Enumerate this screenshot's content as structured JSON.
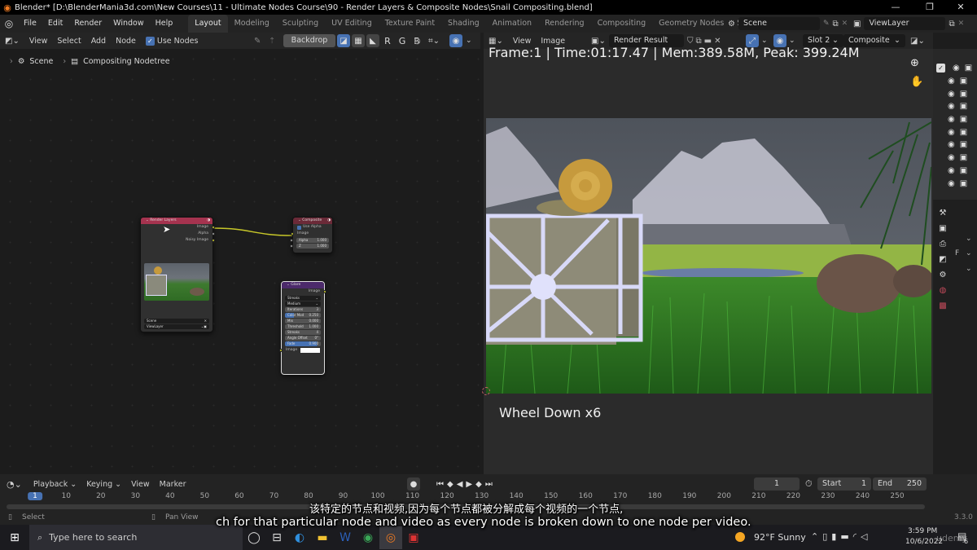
{
  "window": {
    "title": "Blender* [D:\\BlenderMania3d.com\\New Courses\\11 - Ultimate Nodes Course\\90 - Render Layers & Composite Nodes\\Snail Compositing.blend]",
    "minimize": "—",
    "maximize": "❐",
    "close": "✕"
  },
  "menus": [
    "File",
    "Edit",
    "Render",
    "Window",
    "Help"
  ],
  "workspaces": [
    {
      "label": "Layout",
      "active": true
    },
    {
      "label": "Modeling"
    },
    {
      "label": "Sculpting"
    },
    {
      "label": "UV Editing"
    },
    {
      "label": "Texture Paint"
    },
    {
      "label": "Shading"
    },
    {
      "label": "Animation"
    },
    {
      "label": "Rendering"
    },
    {
      "label": "Compositing"
    },
    {
      "label": "Geometry Nodes"
    },
    {
      "label": "Scripting"
    }
  ],
  "add_workspace": "+",
  "scene_selector": "Scene",
  "viewlayer_selector": "ViewLayer",
  "node_editor": {
    "menus": [
      "View",
      "Select",
      "Add",
      "Node"
    ],
    "use_nodes_label": "Use Nodes",
    "use_nodes_checked": true,
    "backdrop_label": "Backdrop",
    "channels": [
      "R",
      "G",
      "B"
    ],
    "breadcrumb": [
      "Scene",
      "Compositing Nodetree"
    ],
    "nodes": {
      "render_layers": {
        "title": "Render Layers",
        "outputs": [
          "Image",
          "Alpha",
          "Noisy Image"
        ],
        "scene": "Scene",
        "view_layer": "ViewLayer",
        "header_color": "#a5334f"
      },
      "composite": {
        "title": "Composite",
        "use_alpha_label": "Use Alpha",
        "use_alpha_checked": true,
        "input_label": "Image",
        "fields": [
          {
            "label": "Alpha",
            "value": "1.000"
          },
          {
            "label": "Z",
            "value": "1.000"
          }
        ],
        "header_color": "#6b2a38"
      },
      "glare": {
        "title": "Glare",
        "output": "Image",
        "dropdowns": [
          "Streaks",
          "Medium"
        ],
        "fields": [
          {
            "label": "Iterations",
            "value": "3"
          },
          {
            "label": "Color Mod",
            "value": "0.250",
            "progress": 0.25
          },
          {
            "label": "Mix",
            "value": "0.000"
          },
          {
            "label": "Threshold",
            "value": "1.000"
          },
          {
            "label": "Streaks",
            "value": "4"
          },
          {
            "label": "Angle Offset",
            "value": "0°"
          },
          {
            "label": "Fade",
            "value": "0.900",
            "progress": 0.9
          }
        ],
        "input_label": "Image",
        "header_color": "#4c2a6b"
      }
    }
  },
  "image_editor": {
    "menus": [
      "View",
      "Image"
    ],
    "image_name": "Render Result",
    "slot": "Slot 2",
    "layer": "Composite",
    "stats": "Frame:1 | Time:01:17.47 | Mem:389.58M, Peak: 399.24M",
    "overlay_text": "Wheel Down x6"
  },
  "outliner_rows": 10,
  "properties_tabs": [
    "tool-icon",
    "render-icon",
    "output-icon",
    "view-layer-icon",
    "scene-icon",
    "world-icon",
    "texture-icon"
  ],
  "properties_letter": "F",
  "timeline": {
    "menus": [
      "Playback",
      "Keying",
      "View",
      "Marker"
    ],
    "current_frame": "1",
    "start_label": "Start",
    "start_value": "1",
    "end_label": "End",
    "end_value": "250",
    "ruler_marks": [
      "1",
      "10",
      "20",
      "30",
      "40",
      "50",
      "60",
      "70",
      "80",
      "90",
      "100",
      "110",
      "120",
      "130",
      "140",
      "150",
      "160",
      "170",
      "180",
      "190",
      "200",
      "210",
      "220",
      "230",
      "240",
      "250"
    ]
  },
  "statusbar": {
    "left_hint": "Select",
    "mid_hint": "Pan View",
    "version": "3.3.0"
  },
  "subtitles": {
    "chinese": "该特定的节点和视频,因为每个节点都被分解成每个视频的一个节点,",
    "english": "ch for that particular node and video as every node is broken down to one node per video."
  },
  "taskbar": {
    "search_placeholder": "Type here to search",
    "weather": "92°F  Sunny",
    "time": "3:59 PM",
    "date": "10/6/2022",
    "notification_count": "6",
    "watermark": "udemy"
  }
}
